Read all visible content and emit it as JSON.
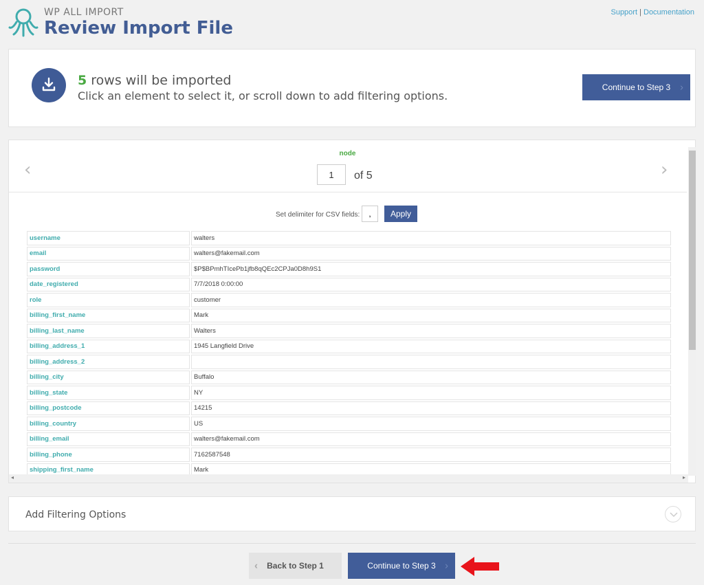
{
  "header": {
    "brand": "WP ALL IMPORT",
    "title": "Review Import File",
    "support_link": "Support",
    "separator": "|",
    "documentation_link": "Documentation"
  },
  "summary": {
    "row_count": "5",
    "rows_text": "rows will be imported",
    "hint": "Click an element to select it, or scroll down to add filtering options.",
    "continue_label": "Continue to Step 3"
  },
  "viewer": {
    "node_label": "node",
    "current_page": "1",
    "of_text": "of 5",
    "delimiter_label": "Set delimiter for CSV fields:",
    "delimiter_value": ",",
    "apply_label": "Apply",
    "rows": [
      {
        "key": "username",
        "value": "walters"
      },
      {
        "key": "email",
        "value": "walters@fakemail.com"
      },
      {
        "key": "password",
        "value": "$P$BPmhTIcePb1jfb8qQEc2CPJa0D8h9S1"
      },
      {
        "key": "date_registered",
        "value": "7/7/2018 0:00:00"
      },
      {
        "key": "role",
        "value": "customer"
      },
      {
        "key": "billing_first_name",
        "value": "Mark"
      },
      {
        "key": "billing_last_name",
        "value": "Walters"
      },
      {
        "key": "billing_address_1",
        "value": "1945 Langfield Drive"
      },
      {
        "key": "billing_address_2",
        "value": ""
      },
      {
        "key": "billing_city",
        "value": "Buffalo"
      },
      {
        "key": "billing_state",
        "value": "NY"
      },
      {
        "key": "billing_postcode",
        "value": "14215"
      },
      {
        "key": "billing_country",
        "value": "US"
      },
      {
        "key": "billing_email",
        "value": "walters@fakemail.com"
      },
      {
        "key": "billing_phone",
        "value": "7162587548"
      },
      {
        "key": "shipping_first_name",
        "value": "Mark"
      }
    ]
  },
  "filtering": {
    "title": "Add Filtering Options"
  },
  "footer": {
    "back_label": "Back to Step 1",
    "continue_label": "Continue to Step 3"
  },
  "colors": {
    "primary": "#415d99",
    "accent_green": "#49a942",
    "teal": "#40acad",
    "annotation_red": "#e8141b"
  },
  "icons": {
    "logo": "octopus-logo-icon",
    "download": "download-icon",
    "prev": "chevron-left-icon",
    "next": "chevron-right-icon",
    "expand": "chevron-down-icon",
    "arrow": "red-arrow-icon"
  }
}
